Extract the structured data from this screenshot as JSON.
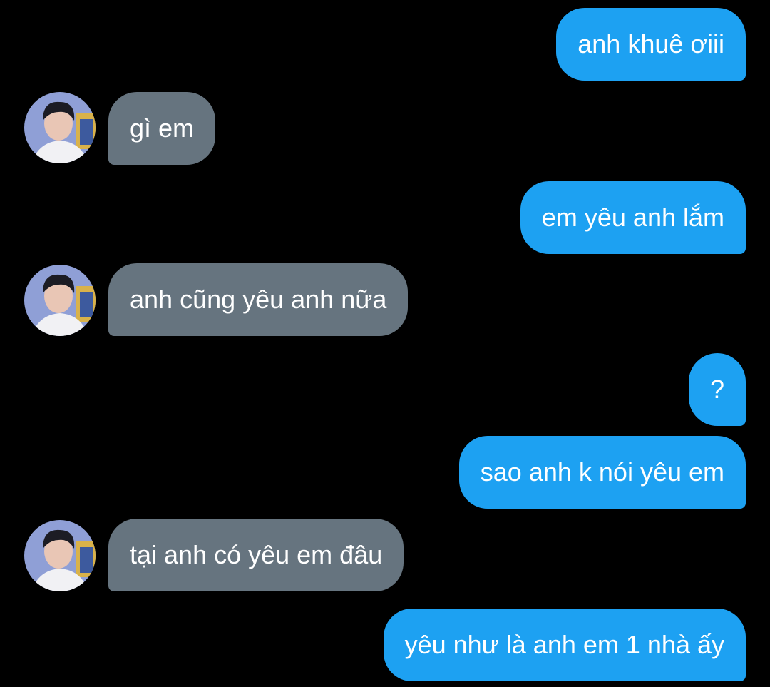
{
  "colors": {
    "background": "#000000",
    "sent_bubble": "#1da1f2",
    "received_bubble": "#66747f",
    "text": "#ffffff"
  },
  "contact": {
    "avatar_icon": "profile-photo-icon"
  },
  "messages": [
    {
      "direction": "sent",
      "text": "anh khuê ơiii"
    },
    {
      "direction": "received",
      "text": "gì em"
    },
    {
      "direction": "sent",
      "text": "em yêu anh lắm"
    },
    {
      "direction": "received",
      "text": "anh cũng yêu anh nữa"
    },
    {
      "direction": "sent",
      "text": "?"
    },
    {
      "direction": "sent",
      "text": "sao anh k nói yêu em"
    },
    {
      "direction": "received",
      "text": "tại anh có yêu em đâu"
    },
    {
      "direction": "sent",
      "text": "yêu như là anh em 1 nhà ấy"
    }
  ]
}
